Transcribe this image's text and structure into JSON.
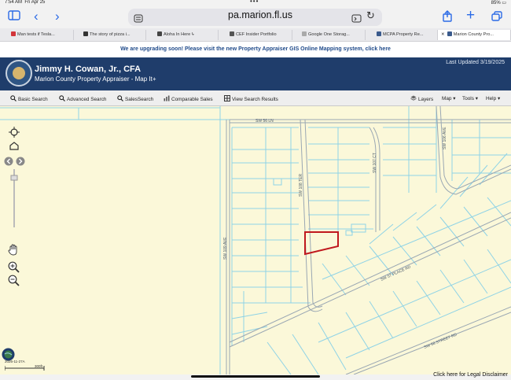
{
  "status": {
    "time": "7:54 AM",
    "date": "Fri Apr 25",
    "battery": "85%"
  },
  "browser": {
    "url": "pa.marion.fl.us"
  },
  "tabs": [
    {
      "label": "Man tests if Tesla...",
      "color": "#d2353a"
    },
    {
      "label": "The story of pizza i...",
      "color": "#333333"
    },
    {
      "label": "Aloha In Here",
      "color": "#444444"
    },
    {
      "label": "CEF Insider Portfolio",
      "color": "#555555"
    },
    {
      "label": "Google One Storag...",
      "color": "#aaaaaa"
    },
    {
      "label": "MCPA Property Re...",
      "color": "#3a5a8c"
    },
    {
      "label": "Marion County Pro...",
      "color": "#3a5a8c"
    }
  ],
  "banner": "We are upgrading soon! Please visit the new Property Appraiser GIS Online Mapping system, click here",
  "header": {
    "name": "Jimmy H. Cowan, Jr., CFA",
    "subtitle": "Marion County Property Appraiser - Map It+",
    "updated": "Last Updated 3/19/2025"
  },
  "toolbar": {
    "basic_search": "Basic Search",
    "advanced_search": "Advanced Search",
    "sales_search": "SalesSearch",
    "comparable_sales": "Comparable Sales",
    "view_results": "View Search Results",
    "layers": "Layers",
    "map": "Map",
    "tools": "Tools",
    "help": "Help"
  },
  "map": {
    "streets": {
      "sw56ln": "SW 56 LN",
      "sw108ter": "SW 108 TER",
      "sw107ct": "SW 107 CT",
      "sw106ave": "SW 106 AVE",
      "sw109ave": "SW 109 AVE",
      "sw57place": "SW 57 PLACE RD",
      "sw58street": "SW 58 STREET RD"
    },
    "scale_label": "300ft",
    "date_label": "2026-11-27A",
    "disclaimer": "Click here for Legal Disclaimer",
    "colors": {
      "background": "#fbf8d9",
      "parcel_line": "#8fd3e6",
      "road_edge": "#9aa7b3",
      "selected_parcel": "#c0181e"
    }
  }
}
